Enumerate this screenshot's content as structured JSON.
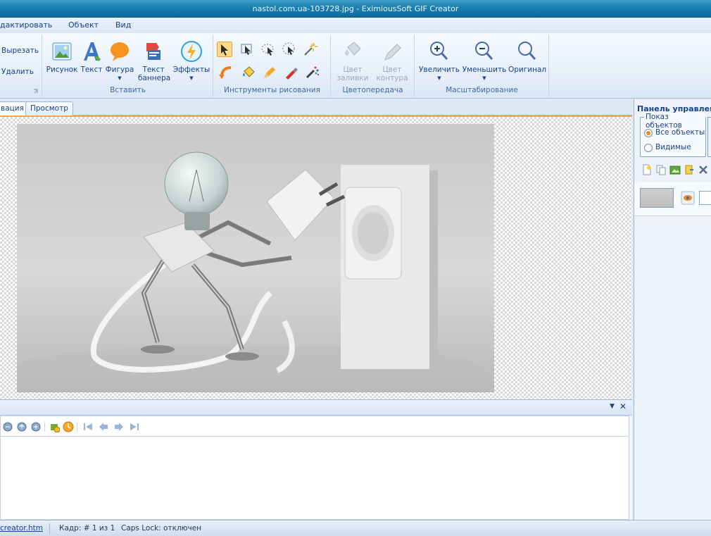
{
  "window": {
    "title": "nastol.com.ua-103728.jpg - EximiousSoft GIF Creator"
  },
  "menu": {
    "items": [
      "дактировать",
      "Объект",
      "Вид"
    ]
  },
  "ribbon": {
    "clipboard": {
      "cut_label": "Вырезать",
      "delete_label": "Удалить"
    },
    "insert": {
      "group_label": "Вставить",
      "buttons": [
        "Рисунок",
        "Текст",
        "Фигура",
        "Текст баннера",
        "Эффекты"
      ]
    },
    "drawing": {
      "group_label": "Инструменты рисования"
    },
    "color": {
      "group_label": "Цветопередача",
      "fill_label": "Цвет заливки",
      "outline_label": "Цвет контура"
    },
    "zoom": {
      "group_label": "Масштабирование",
      "zoom_in": "Увеличить",
      "zoom_out": "Уменьшить",
      "original": "Оригинал"
    }
  },
  "tabs": {
    "items": [
      "вация",
      "Просмотр"
    ]
  },
  "right_panel": {
    "title": "Панель управлени",
    "show_objects_label": "Показ объектов",
    "radio_all": "Все объекты",
    "radio_visible": "Видимые",
    "selected": "all"
  },
  "status": {
    "link": "creator.htm",
    "frame": "Кадр: # 1 из 1",
    "caps": "Caps Lock: отключен"
  },
  "colors": {
    "accent": "#1a7fb2",
    "selection": "#f0a84a",
    "text": "#15428b"
  }
}
